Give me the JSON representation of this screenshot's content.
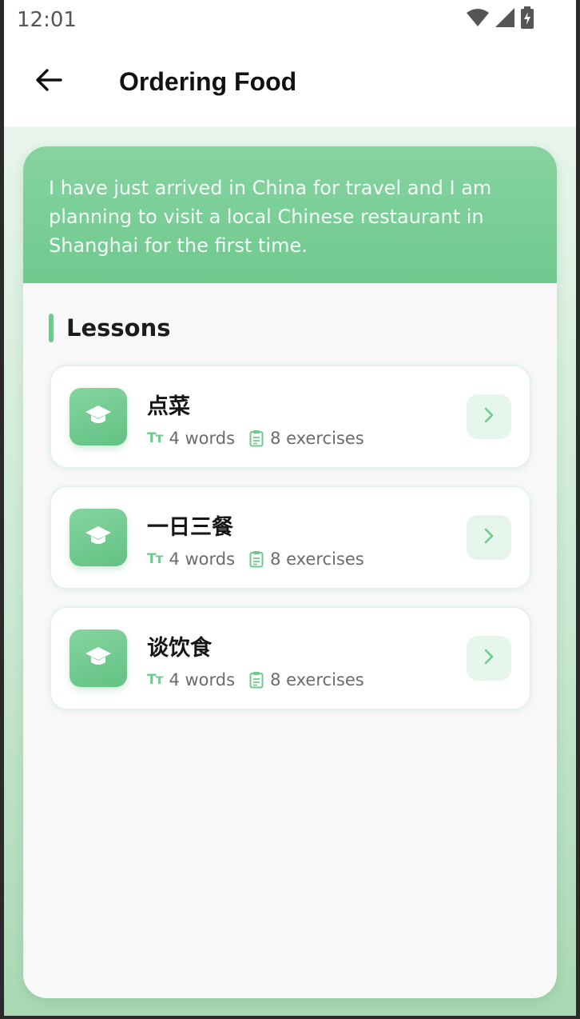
{
  "status_bar": {
    "time": "12:01",
    "icons": [
      "wifi-icon",
      "signal-icon",
      "battery-charging-icon"
    ]
  },
  "app_bar": {
    "back_icon": "arrow-left-icon",
    "title": "Ordering Food"
  },
  "scenario": {
    "description": "I have just arrived in China for travel and I am planning to visit a local Chinese restaurant in Shanghai for the first time."
  },
  "lessons_section": {
    "title": "Lessons",
    "items": [
      {
        "title": "点菜",
        "words": "4 words",
        "exercises": "8 exercises",
        "icon": "graduation-cap-icon"
      },
      {
        "title": "一日三餐",
        "words": "4 words",
        "exercises": "8 exercises",
        "icon": "graduation-cap-icon"
      },
      {
        "title": "谈饮食",
        "words": "4 words",
        "exercises": "8 exercises",
        "icon": "graduation-cap-icon"
      }
    ]
  },
  "colors": {
    "accent": "#6fca8e",
    "header_gradient_start": "#87d3a1",
    "chevron_bg": "#e6f5eb",
    "background_bottom": "#a9d8b3"
  }
}
